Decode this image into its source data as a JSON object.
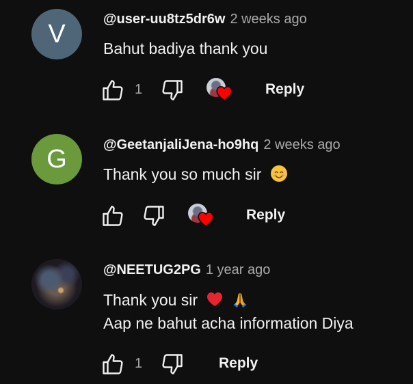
{
  "comments": [
    {
      "avatar_letter": "V",
      "avatar_color": "#4f6678",
      "handle": "@user-uu8tz5dr6w",
      "time": "2 weeks ago",
      "lines": [
        "Bahut badiya thank you"
      ],
      "like_count": "1",
      "creator_heart": true,
      "reply_label": "Reply"
    },
    {
      "avatar_letter": "G",
      "avatar_color": "#6a9a3c",
      "handle": "@GeetanjaliJena-ho9hq",
      "time": "2 weeks ago",
      "lines": [
        "Thank you so much sir"
      ],
      "line_emoji": "smiling-face-emoji",
      "like_count": "",
      "creator_heart": true,
      "reply_label": "Reply"
    },
    {
      "avatar_letter": "",
      "handle": "@NEETUG2PG",
      "time": "1 year ago",
      "lines": [
        "Thank you sir",
        "Aap ne bahut acha information Diya"
      ],
      "line_emoji": [
        "red-heart-emoji",
        "folded-hands-emoji"
      ],
      "like_count": "1",
      "creator_heart": false,
      "reply_label": "Reply"
    }
  ],
  "icons": {
    "like": "thumbs-up-icon",
    "dislike": "thumbs-down-icon",
    "creator_heart": "creator-heart-badge"
  },
  "colors": {
    "background": "#0f0f0f",
    "text_primary": "#f1f1f1",
    "text_secondary": "#aaaaaa",
    "heart": "#ff0000"
  }
}
